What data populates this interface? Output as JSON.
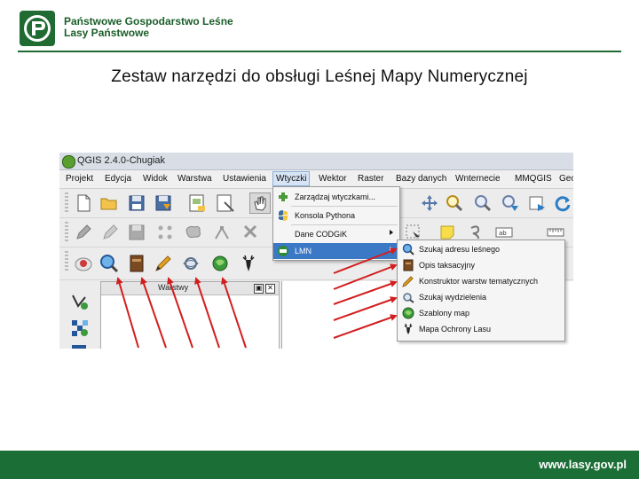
{
  "header": {
    "org_line1": "Państwowe Gospodarstwo Leśne",
    "org_line2": "Lasy Państwowe",
    "logo_text": "LASY PAŃSTWOWE"
  },
  "slide": {
    "title": "Zestaw narzędzi do obsługi Leśnej Mapy Numerycznej"
  },
  "app": {
    "window_title": "QGIS 2.4.0-Chugiak",
    "menu": [
      "Projekt",
      "Edycja",
      "Widok",
      "Warstwa",
      "Ustawienia",
      "Wtyczki",
      "Wektor",
      "Raster",
      "Bazy danych",
      "Wnternecie",
      "MMQGIS",
      "Geo"
    ],
    "open_menu": "Wtyczki",
    "plugins_menu": [
      {
        "label": "Zarządzaj wtyczkami...",
        "icon": "plugin-icon"
      },
      {
        "label": "Konsola Pythona",
        "icon": "python-icon"
      },
      {
        "label": "Dane CODGiK",
        "icon": "",
        "submenu": true
      },
      {
        "label": "LMN",
        "icon": "lmn-icon",
        "submenu": true,
        "selected": true
      }
    ],
    "lmn_submenu": [
      {
        "label": "Szukaj adresu leśnego",
        "icon": "magnifier-icon"
      },
      {
        "label": "Opis taksacyjny",
        "icon": "book-icon"
      },
      {
        "label": "Konstruktor warstw tematycznych",
        "icon": "pencil-icon"
      },
      {
        "label": "Szukaj wydzielenia",
        "icon": "search-parcel-icon"
      },
      {
        "label": "Szablony map",
        "icon": "map-template-icon"
      },
      {
        "label": "Mapa Ochrony Lasu",
        "icon": "deer-icon"
      }
    ],
    "layers_panel_title": "Warstwy"
  },
  "footer": {
    "url": "www.lasy.gov.pl"
  },
  "colors": {
    "brand_green": "#1b6e35",
    "arrow_red": "#d21e1e",
    "menu_highlight": "#3b78c6"
  }
}
